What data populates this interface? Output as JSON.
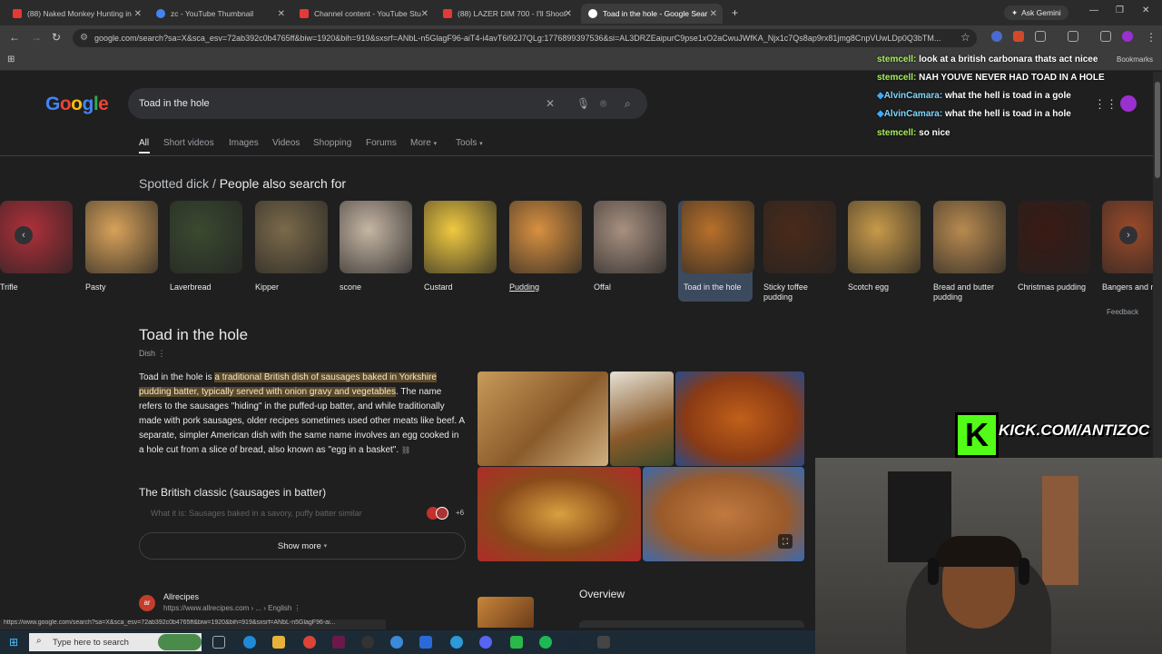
{
  "tabs": [
    {
      "label": "(88) Naked Monkey Hunting in",
      "color": "#e53935",
      "active": false
    },
    {
      "label": "zc - YouTube Thumbnail",
      "color": "#4285f4",
      "active": false
    },
    {
      "label": "Channel content - YouTube Stu",
      "color": "#e53935",
      "active": false
    },
    {
      "label": "(88) LAZER DIM 700 - I'll Shoot",
      "color": "#e53935",
      "active": false
    },
    {
      "label": "Toad in the hole - Google Sear",
      "color": "#4285f4",
      "active": true
    }
  ],
  "ask_gemini": "Ask Gemini",
  "url": "google.com/search?sa=X&sca_esv=72ab392c0b4765ff&biw=1920&bih=919&sxsrf=ANbL-n5GlagF96-aiT4-i4avT6i92J7QLg:1776899397536&si=AL3DRZEaipurC9pse1xO2aCwuJWfKA_Njx1c7Qs8ap9rx81jmg8CnpVUwLDp0Q3bTM...",
  "bookmarks_label": "Bookmarks",
  "search": {
    "query": "Toad in the hole"
  },
  "logo_text": "Google",
  "nav_tabs": [
    "All",
    "Short videos",
    "Images",
    "Videos",
    "Shopping",
    "Forums",
    "More",
    "Tools"
  ],
  "pasf": {
    "prefix": "Spotted dick /",
    "title": "People also search for",
    "items": [
      {
        "label": "Trifle",
        "color": "#b0303a"
      },
      {
        "label": "Pasty",
        "color": "#d8a25a"
      },
      {
        "label": "Laverbread",
        "color": "#3a4a30"
      },
      {
        "label": "Kipper",
        "color": "#7a6a4a"
      },
      {
        "label": "scone",
        "color": "#c6b6a4"
      },
      {
        "label": "Custard",
        "color": "#f0c940"
      },
      {
        "label": "Pudding",
        "color": "#d89040"
      },
      {
        "label": "Offal",
        "color": "#a89080"
      },
      {
        "label": "Toad in the hole",
        "color": "#b8702a"
      },
      {
        "label": "Sticky toffee pudding",
        "color": "#4a2a1a"
      },
      {
        "label": "Scotch egg",
        "color": "#c89a4a"
      },
      {
        "label": "Bread and butter pudding",
        "color": "#b88a50"
      },
      {
        "label": "Christmas pudding",
        "color": "#3a1a14"
      },
      {
        "label": "Bangers and mash",
        "color": "#9a4a2a"
      }
    ],
    "feedback": "Feedback"
  },
  "knowledge_panel": {
    "title": "Toad in the hole",
    "subtitle": "Dish",
    "desc_start": "Toad in the hole is ",
    "desc_highlight": "a traditional British dish of sausages baked in Yorkshire pudding batter, typically served with onion gravy and vegetables",
    "desc_rest": ". The name refers to the sausages \"hiding\" in the puffed-up batter, and while traditionally made with pork sausages, older recipes sometimes used other meats like beef. A separate, simpler American dish with the same name involves an egg cooked in a hole cut from a slice of bread, also known as \"egg in a basket\".",
    "section_heading": "The British classic (sausages in batter)",
    "section_fade": "What it is: Sausages baked in a savory, puffy batter similar",
    "source_count": "+6",
    "show_more": "Show more",
    "overview": "Overview"
  },
  "result": {
    "name": "Allrecipes",
    "url": "https://www.allrecipes.com › ... › English",
    "logo": "ar"
  },
  "chat": [
    {
      "user": "stemcell:",
      "msg": "look at a british carbonara thats act nicee"
    },
    {
      "user": "stemcell:",
      "msg": "NAH YOUVE NEVER HAD TOAD IN A HOLE"
    },
    {
      "user": "AlvinCamara:",
      "msg": "what the hell is toad in a gole"
    },
    {
      "user": "AlvinCamara:",
      "msg": "what the hell is toad in a hole"
    },
    {
      "user": "stemcell:",
      "msg": "so nice"
    }
  ],
  "kick": {
    "letter": "K",
    "text": "KICK.COM/ANTIZOC"
  },
  "status_url": "https://www.google.com/search?sa=X&sca_esv=72ab392c0b4765ff&biw=1920&bih=919&sxsrf=ANbL-n5GlagF96-ai...",
  "taskbar": {
    "search_placeholder": "Type here to search"
  }
}
